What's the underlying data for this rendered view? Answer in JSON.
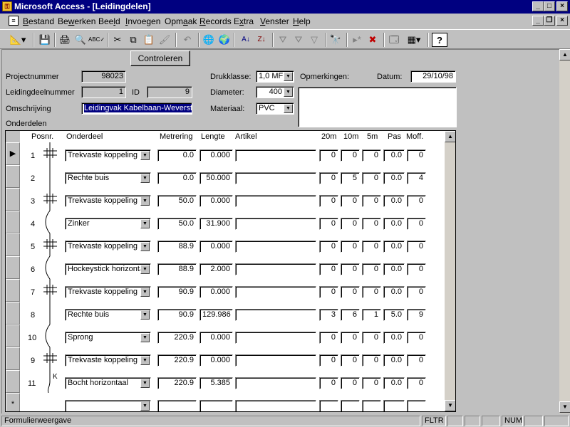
{
  "app": {
    "title": "Microsoft Access - [Leidingdelen]",
    "icon": "key-icon"
  },
  "menu": {
    "items": [
      {
        "label": "Bestand",
        "u": "B",
        "rest": "estand"
      },
      {
        "label": "Bewerken",
        "u": "w",
        "pre": "Be",
        "rest": "erken"
      },
      {
        "label": "Beeld",
        "u": "l",
        "pre": "Bee",
        "rest": "d"
      },
      {
        "label": "Invoegen",
        "u": "I",
        "rest": "nvoegen"
      },
      {
        "label": "Opmaak",
        "u": "a",
        "pre": "Opm",
        "rest": "ak"
      },
      {
        "label": "Records",
        "u": "R",
        "rest": "ecords"
      },
      {
        "label": "Extra",
        "u": "x",
        "pre": "E",
        "rest": "tra"
      },
      {
        "label": "Venster",
        "u": "V",
        "rest": "enster"
      },
      {
        "label": "Help",
        "u": "H",
        "rest": "elp"
      }
    ]
  },
  "form": {
    "controleren_label": "Controleren",
    "projectnummer_label": "Projectnummer",
    "projectnummer": "98023",
    "leidingdeelnummer_label": "Leidingdeelnummer",
    "leidingdeelnummer": "1",
    "id_label": "ID",
    "id": "9",
    "omschrijving_label": "Omschrijving",
    "omschrijving": "Leidingvak Kabelbaan-Weverst",
    "drukklasse_label": "Drukklasse:",
    "drukklasse": "1,0 MF",
    "diameter_label": "Diameter:",
    "diameter": "400",
    "materiaal_label": "Materiaal:",
    "materiaal": "PVC",
    "opmerkingen_label": "Opmerkingen:",
    "opmerkingen": "",
    "datum_label": "Datum:",
    "datum": "29/10/98",
    "onderdelen_label": "Onderdelen"
  },
  "subform": {
    "headers": {
      "posnr": "Posnr.",
      "onderdeel": "Onderdeel",
      "metrering": "Metrering",
      "lengte": "Lengte",
      "artikel": "Artikel",
      "c20m": "20m",
      "c10m": "10m",
      "c5m": "5m",
      "pas": "Pas",
      "moff": "Moff."
    },
    "new_record_marker": "*",
    "current_marker": "▶",
    "rows": [
      {
        "posnr": "1",
        "onderdeel": "Trekvaste koppeling",
        "metrering": "0.0",
        "lengte": "0.000",
        "artikel": "",
        "c20m": "0",
        "c10m": "0",
        "c5m": "0",
        "pas": "0.0",
        "moff": "0",
        "symbol": "coupling"
      },
      {
        "posnr": "2",
        "onderdeel": "Rechte buis",
        "metrering": "0.0",
        "lengte": "50.000",
        "artikel": "",
        "c20m": "0",
        "c10m": "5",
        "c5m": "0",
        "pas": "0.0",
        "moff": "4",
        "symbol": "pipe"
      },
      {
        "posnr": "3",
        "onderdeel": "Trekvaste koppeling",
        "metrering": "50.0",
        "lengte": "0.000",
        "artikel": "",
        "c20m": "0",
        "c10m": "0",
        "c5m": "0",
        "pas": "0.0",
        "moff": "0",
        "symbol": "coupling"
      },
      {
        "posnr": "4",
        "onderdeel": "Zinker",
        "metrering": "50.0",
        "lengte": "31.900",
        "artikel": "",
        "c20m": "0",
        "c10m": "0",
        "c5m": "0",
        "pas": "0.0",
        "moff": "0",
        "symbol": "curve"
      },
      {
        "posnr": "5",
        "onderdeel": "Trekvaste koppeling",
        "metrering": "88.9",
        "lengte": "0.000",
        "artikel": "",
        "c20m": "0",
        "c10m": "0",
        "c5m": "0",
        "pas": "0.0",
        "moff": "0",
        "symbol": "coupling"
      },
      {
        "posnr": "6",
        "onderdeel": "Hockeystick horizontaal",
        "metrering": "88.9",
        "lengte": "2.000",
        "artikel": "",
        "c20m": "0",
        "c10m": "0",
        "c5m": "0",
        "pas": "0.0",
        "moff": "0",
        "symbol": "curve"
      },
      {
        "posnr": "7",
        "onderdeel": "Trekvaste koppeling",
        "metrering": "90.9",
        "lengte": "0.000",
        "artikel": "",
        "c20m": "0",
        "c10m": "0",
        "c5m": "0",
        "pas": "0.0",
        "moff": "0",
        "symbol": "coupling"
      },
      {
        "posnr": "8",
        "onderdeel": "Rechte buis",
        "metrering": "90.9",
        "lengte": "129.986",
        "artikel": "",
        "c20m": "3",
        "c10m": "6",
        "c5m": "1",
        "pas": "5.0",
        "moff": "9",
        "symbol": "pipe"
      },
      {
        "posnr": "10",
        "onderdeel": "Sprong",
        "metrering": "220.9",
        "lengte": "0.000",
        "artikel": "",
        "c20m": "0",
        "c10m": "0",
        "c5m": "0",
        "pas": "0.0",
        "moff": "0",
        "symbol": "curve"
      },
      {
        "posnr": "9",
        "onderdeel": "Trekvaste koppeling",
        "metrering": "220.9",
        "lengte": "0.000",
        "artikel": "",
        "c20m": "0",
        "c10m": "0",
        "c5m": "0",
        "pas": "0.0",
        "moff": "0",
        "symbol": "coupling"
      },
      {
        "posnr": "11",
        "onderdeel": "Bocht horizontaal",
        "metrering": "220.9",
        "lengte": "5.385",
        "artikel": "",
        "c20m": "0",
        "c10m": "0",
        "c5m": "0",
        "pas": "0.0",
        "moff": "0",
        "symbol": "bend",
        "symbol_text": "K"
      }
    ]
  },
  "status": {
    "text": "Formulierweergave",
    "fltr": "FLTR",
    "num": "NUM"
  }
}
